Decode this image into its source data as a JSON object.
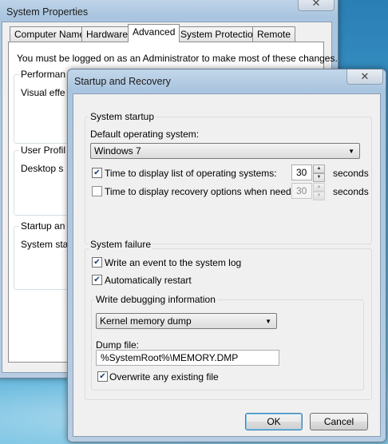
{
  "system_properties": {
    "title": "System Properties",
    "close_glyph": "✕",
    "tabs": [
      "Computer Name",
      "Hardware",
      "Advanced",
      "System Protection",
      "Remote"
    ],
    "admin_note": "You must be logged on as an Administrator to make most of these changes.",
    "sections": {
      "performance_title": "Performan",
      "performance_text": "Visual effe",
      "user_profiles_title": "User Profil",
      "user_profiles_text": "Desktop s",
      "startup_title": "Startup an",
      "startup_text": "System sta"
    }
  },
  "dialog": {
    "title": "Startup and Recovery",
    "close_glyph": "✕",
    "system_startup": {
      "legend": "System startup",
      "default_os_label": "Default operating system:",
      "default_os_value": "Windows 7",
      "show_list_label": "Time to display list of operating systems:",
      "show_list_checked": true,
      "show_list_value": "30",
      "show_recovery_label": "Time to display recovery options when needed:",
      "show_recovery_checked": false,
      "show_recovery_value": "30",
      "seconds_label": "seconds"
    },
    "system_failure": {
      "legend": "System failure",
      "write_event_label": "Write an event to the system log",
      "write_event_checked": true,
      "auto_restart_label": "Automatically restart",
      "auto_restart_checked": true,
      "debug_legend": "Write debugging information",
      "debug_type_value": "Kernel memory dump",
      "dump_file_label": "Dump file:",
      "dump_file_value": "%SystemRoot%\\MEMORY.DMP",
      "overwrite_label": "Overwrite any existing file",
      "overwrite_checked": true
    },
    "ok_label": "OK",
    "cancel_label": "Cancel"
  },
  "icons": {
    "check": "✔",
    "dropdown_arrow": "▼",
    "spin_up": "▲",
    "spin_down": "▼"
  }
}
